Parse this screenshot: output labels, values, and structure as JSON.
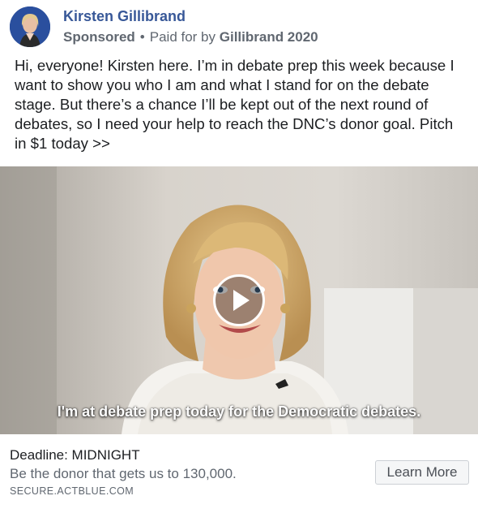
{
  "post": {
    "page_name": "Kirsten Gillibrand",
    "sponsored_label": "Sponsored",
    "separator": "•",
    "paid_for_prefix": "Paid for by",
    "paid_for_name": "Gillibrand 2020",
    "body_text": "Hi, everyone! Kirsten here. I’m in debate prep this week because I want to show you who I am and what I stand for on the debate stage. But there’s a chance I’ll be kept out of the next round of debates, so I need your help to reach the DNC’s donor goal. Pitch in $1 today >>"
  },
  "video": {
    "caption": "I'm at debate prep today for the Democratic debates.",
    "play_icon": "play-icon"
  },
  "link": {
    "headline": "Deadline: MIDNIGHT",
    "description": "Be the donor that gets us to 130,000.",
    "domain": "SECURE.ACTBLUE.COM",
    "cta_label": "Learn More"
  },
  "colors": {
    "page_name": "#385898",
    "secondary_text": "#606770",
    "body_text": "#1c1e21",
    "button_bg": "#f5f6f7"
  }
}
